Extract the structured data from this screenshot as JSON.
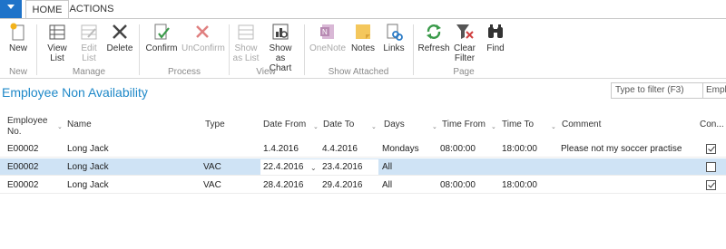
{
  "tabs": {
    "home": "HOME",
    "actions": "ACTIONS"
  },
  "ribbon": {
    "new": "New",
    "view_list": [
      "View",
      "List"
    ],
    "edit_list": [
      "Edit",
      "List"
    ],
    "delete": "Delete",
    "confirm": "Confirm",
    "unconfirm": "UnConfirm",
    "show_as_list": [
      "Show",
      "as List"
    ],
    "show_as_chart": [
      "Show as",
      "Chart"
    ],
    "onenote": "OneNote",
    "notes": "Notes",
    "links": "Links",
    "refresh": "Refresh",
    "clear_filter": [
      "Clear",
      "Filter"
    ],
    "find": "Find",
    "groups": {
      "new": "New",
      "manage": "Manage",
      "process": "Process",
      "view": "View",
      "show_attached": "Show Attached",
      "page": "Page"
    }
  },
  "page": {
    "title": "Employee Non Availability",
    "title_menu": "·"
  },
  "filter": {
    "placeholder": "Type to filter (F3)",
    "field": "Employee No."
  },
  "columns": {
    "employee_no": [
      "Employee",
      "No."
    ],
    "name": "Name",
    "type": "Type",
    "date_from": "Date From",
    "date_to": "Date To",
    "days": "Days",
    "time_from": "Time From",
    "time_to": "Time To",
    "comment": "Comment",
    "confirmed": "Con..."
  },
  "rows": [
    {
      "employee_no": "E00002",
      "name": "Long Jack",
      "type": "",
      "date_from": "1.4.2016",
      "date_to": "4.4.2016",
      "days": "Mondays",
      "time_from": "08:00:00",
      "time_to": "18:00:00",
      "comment": "Please not my soccer practise",
      "confirmed": true
    },
    {
      "employee_no": "E00002",
      "name": "Long Jack",
      "type": "VAC",
      "date_from": "22.4.2016",
      "date_to": "23.4.2016",
      "days": "All",
      "time_from": "",
      "time_to": "",
      "comment": "",
      "confirmed": false
    },
    {
      "employee_no": "E00002",
      "name": "Long Jack",
      "type": "VAC",
      "date_from": "28.4.2016",
      "date_to": "29.4.2016",
      "days": "All",
      "time_from": "08:00:00",
      "time_to": "18:00:00",
      "comment": "",
      "confirmed": true
    }
  ],
  "colors": {
    "accent": "#1e88c8",
    "selected_row": "#cfe3f5",
    "app_button": "#1f73c9"
  }
}
